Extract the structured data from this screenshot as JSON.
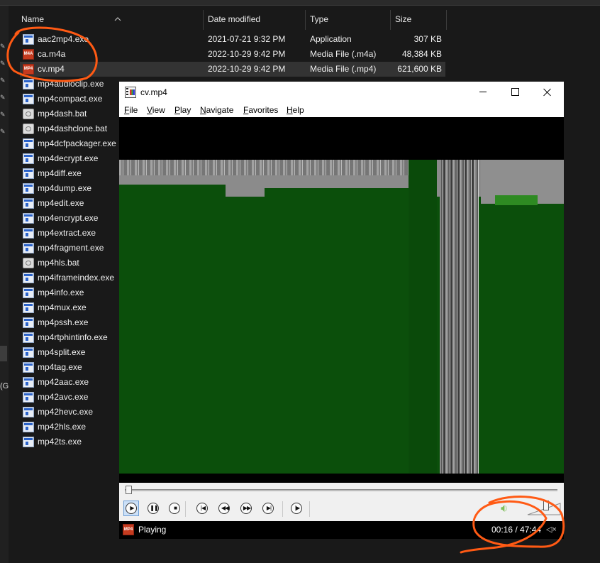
{
  "explorer": {
    "columns": {
      "name": "Name",
      "date": "Date modified",
      "type": "Type",
      "size": "Size"
    },
    "left_label": "(G",
    "files": [
      {
        "name": "aac2mp4.exe",
        "date": "2021-07-21 9:32 PM",
        "type": "Application",
        "size": "307 KB",
        "icon": "exe-file-icon"
      },
      {
        "name": "ca.m4a",
        "date": "2022-10-29 9:42 PM",
        "type": "Media File (.m4a)",
        "size": "48,384 KB",
        "icon": "media-file-icon"
      },
      {
        "name": "cv.mp4",
        "date": "2022-10-29 9:42 PM",
        "type": "Media File (.mp4)",
        "size": "621,600 KB",
        "icon": "media-file-icon",
        "selected": true
      },
      {
        "name": "mp4audioclip.exe",
        "icon": "exe-file-icon"
      },
      {
        "name": "mp4compact.exe",
        "icon": "exe-file-icon"
      },
      {
        "name": "mp4dash.bat",
        "icon": "batch-file-icon"
      },
      {
        "name": "mp4dashclone.bat",
        "icon": "batch-file-icon"
      },
      {
        "name": "mp4dcfpackager.exe",
        "icon": "exe-file-icon"
      },
      {
        "name": "mp4decrypt.exe",
        "icon": "exe-file-icon"
      },
      {
        "name": "mp4diff.exe",
        "icon": "exe-file-icon"
      },
      {
        "name": "mp4dump.exe",
        "icon": "exe-file-icon"
      },
      {
        "name": "mp4edit.exe",
        "icon": "exe-file-icon"
      },
      {
        "name": "mp4encrypt.exe",
        "icon": "exe-file-icon"
      },
      {
        "name": "mp4extract.exe",
        "icon": "exe-file-icon"
      },
      {
        "name": "mp4fragment.exe",
        "icon": "exe-file-icon"
      },
      {
        "name": "mp4hls.bat",
        "icon": "batch-file-icon"
      },
      {
        "name": "mp4iframeindex.exe",
        "icon": "exe-file-icon"
      },
      {
        "name": "mp4info.exe",
        "icon": "exe-file-icon"
      },
      {
        "name": "mp4mux.exe",
        "icon": "exe-file-icon"
      },
      {
        "name": "mp4pssh.exe",
        "icon": "exe-file-icon"
      },
      {
        "name": "mp4rtphintinfo.exe",
        "icon": "exe-file-icon"
      },
      {
        "name": "mp4split.exe",
        "icon": "exe-file-icon"
      },
      {
        "name": "mp4tag.exe",
        "icon": "exe-file-icon"
      },
      {
        "name": "mp42aac.exe",
        "icon": "exe-file-icon"
      },
      {
        "name": "mp42avc.exe",
        "icon": "exe-file-icon"
      },
      {
        "name": "mp42hevc.exe",
        "icon": "exe-file-icon"
      },
      {
        "name": "mp42hls.exe",
        "icon": "exe-file-icon"
      },
      {
        "name": "mp42ts.exe",
        "icon": "exe-file-icon"
      }
    ]
  },
  "player": {
    "title": "cv.mp4",
    "menu": [
      "File",
      "View",
      "Play",
      "Navigate",
      "Favorites",
      "Help"
    ],
    "controls": [
      {
        "name": "play-button",
        "glyph": "▶",
        "pressed": true
      },
      {
        "name": "pause-button",
        "glyph": "❚❚"
      },
      {
        "name": "stop-button",
        "glyph": "■"
      },
      {
        "name": "previous-button",
        "glyph": "|◀"
      },
      {
        "name": "rewind-button",
        "glyph": "◀◀"
      },
      {
        "name": "fast-forward-button",
        "glyph": "▶▶"
      },
      {
        "name": "next-button",
        "glyph": "▶|"
      },
      {
        "name": "frame-step-button",
        "glyph": "|▶"
      }
    ],
    "seek_fraction": 0.0056,
    "volume_fraction": 0.6,
    "status": {
      "state": "Playing",
      "time": "00:16 / 47:44",
      "media_icon_text": "MP4"
    }
  },
  "colors": {
    "explorer_bg": "#191919",
    "video_green": "#0b4f0b",
    "annotation_orange": "#ff5a14"
  }
}
